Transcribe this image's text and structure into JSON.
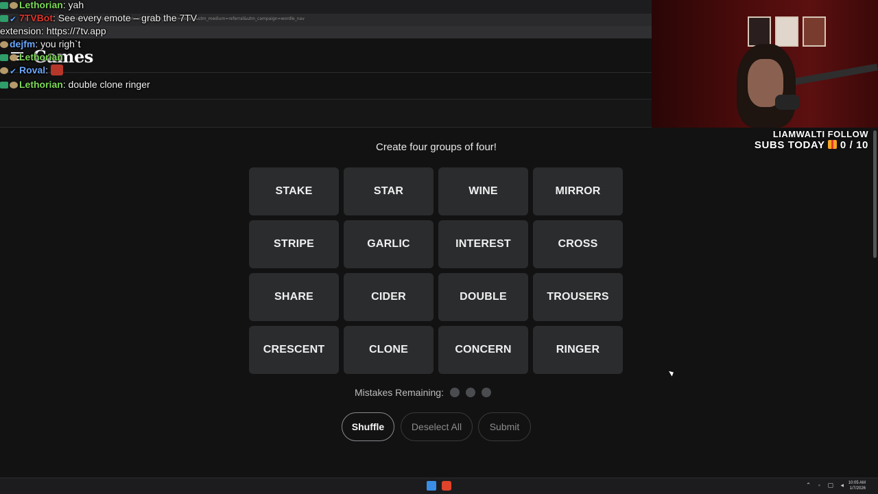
{
  "browser": {
    "url": "https://www.nytimes.com/games/connections?utm_source=wordle&utm_medium=referral&utm_campaign=wordle_nav"
  },
  "site": {
    "logo": "Games"
  },
  "chat": {
    "messages": [
      {
        "user": "Lethorian",
        "text": ": yah",
        "user_color": "#7ed957"
      },
      {
        "user": "7TVBot",
        "text": ": See every emote – grab the 7TV",
        "user_color": "#e0362c"
      },
      {
        "user": "",
        "text": "extension: https://7tv.app",
        "user_color": "#ffffff"
      },
      {
        "user": "dejfm",
        "text": ": you righ`t",
        "user_color": "#6aa8ff"
      },
      {
        "user": "Lethorian",
        "text": "",
        "user_color": "#7ed957"
      },
      {
        "user": "Roval",
        "text": ":",
        "user_color": "#6aa8ff"
      },
      {
        "user": "Lethorian",
        "text": ": double clone ringer",
        "user_color": "#7ed957"
      }
    ]
  },
  "overlay": {
    "follow_line1": "LIAMWALTI FOLLOW",
    "follow_line2_prefix": "SUBS TODAY",
    "subs_count": "0 / 10"
  },
  "game": {
    "instruction": "Create four groups of four!",
    "tiles": [
      "STAKE",
      "STAR",
      "WINE",
      "MIRROR",
      "STRIPE",
      "GARLIC",
      "INTEREST",
      "CROSS",
      "SHARE",
      "CIDER",
      "DOUBLE",
      "TROUSERS",
      "CRESCENT",
      "CLONE",
      "CONCERN",
      "RINGER"
    ],
    "mistakes_label": "Mistakes Remaining:",
    "mistakes_remaining": 3,
    "buttons": {
      "shuffle": "Shuffle",
      "deselect": "Deselect All",
      "submit": "Submit"
    }
  },
  "taskbar": {
    "time": "10:05 AM",
    "date": "1/7/2026"
  },
  "colors": {
    "background": "#121213",
    "tile": "#2a2c2e",
    "dot": "#4a4c4f"
  }
}
